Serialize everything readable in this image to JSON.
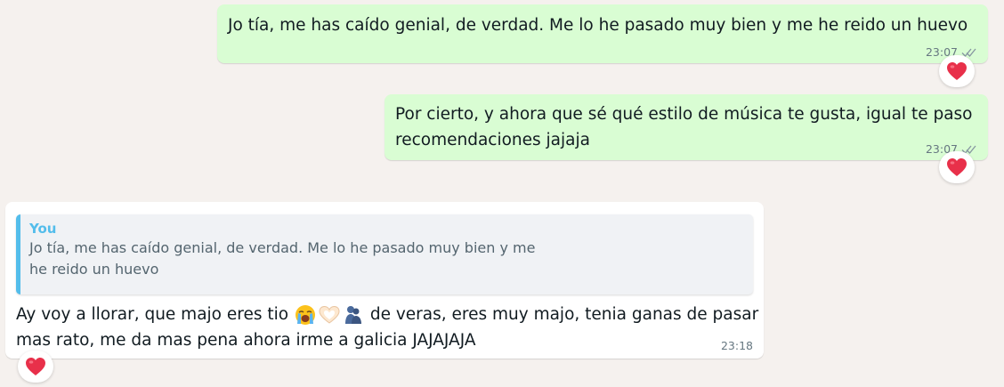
{
  "messages": [
    {
      "direction": "outgoing",
      "text": "Jo tía, me has caído genial, de verdad. Me lo he pasado muy bien y me he reido un huevo",
      "time": "23:07",
      "status": "read-double-tick",
      "reaction": "red-heart"
    },
    {
      "direction": "outgoing",
      "text_line1": "Por cierto, y ahora que sé qué estilo de música te gusta, igual te paso",
      "text_line2": "recomendaciones jajaja",
      "time": "23:07",
      "status": "read-double-tick",
      "reaction": "red-heart"
    },
    {
      "direction": "incoming",
      "quote": {
        "author": "You",
        "line1": "Jo tía, me has caído genial, de verdad. Me lo he pasado muy bien y me",
        "line2": "he reido un huevo"
      },
      "text_before_emoji": "Ay voy a llorar, que majo eres tio ",
      "emojis": [
        "crying-face-emoji",
        "heart-hands-emoji",
        "hugging-people-emoji"
      ],
      "text_after_emoji": " de veras, eres muy majo, tenia ganas de pasar",
      "text_line2": "mas rato, me da mas pena ahora irme a galicia JAJAJAJA",
      "time": "23:18",
      "reaction": "red-heart"
    }
  ],
  "colors": {
    "background": "#f5f1ee",
    "outgoing_bubble": "#d9fdd3",
    "incoming_bubble": "#ffffff",
    "quote_accent": "#53bdeb",
    "heart": "#e8304a"
  }
}
